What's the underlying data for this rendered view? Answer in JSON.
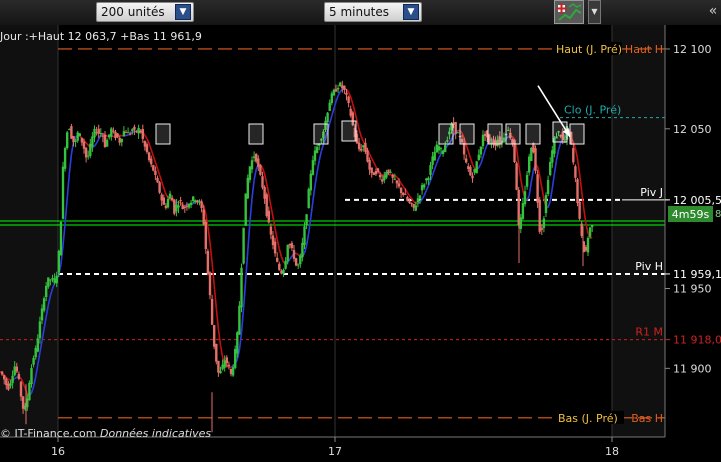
{
  "toolbar": {
    "units_select": "200 unités",
    "interval_select": "5 minutes",
    "dropdown_arrow": "▼",
    "scroll_right": "«"
  },
  "chart": {
    "info_text": "Jour :+Haut 12 063,7 +Bas 11 961,9",
    "watermark": "© IT-Finance.com",
    "watermark_note": "Données indicatives",
    "countdown": "4m59s",
    "countdown_side": "8",
    "colors": {
      "up": "#35c23e",
      "down": "#e5706a",
      "ma_up": "#2b3fe0",
      "ma_down": "#c31010",
      "hilite": "#00ff00",
      "resistance": "#e06020",
      "close_line": "#22aaaa",
      "r1_line": "#cc2222"
    }
  },
  "chart_data": {
    "type": "candlestick",
    "title": "",
    "xlabel": "",
    "ylabel": "",
    "ylim": [
      11857,
      12115
    ],
    "x_ticks": [
      "16",
      "17",
      "18"
    ],
    "y_ticks": [
      "12 100",
      "12 050",
      "12 005,5",
      "11 950",
      "11 900"
    ],
    "levels": [
      {
        "value": 12100,
        "left_label": "Haut (J. Pré)",
        "right_label": "Haut H",
        "badge": "",
        "style": "resistance"
      },
      {
        "value": 12057,
        "left_label": "Clo (J. Pré)",
        "right_label": "",
        "badge": "",
        "style": "close"
      },
      {
        "value": 12005.5,
        "left_label": "",
        "right_label": "Piv J",
        "badge": "12 005,5",
        "style": "pivot"
      },
      {
        "value": 11991,
        "left_label": "",
        "right_label": "",
        "badge": "",
        "style": "current"
      },
      {
        "value": 11959.1,
        "left_label": "",
        "right_label": "Piv H",
        "badge": "11 959,1",
        "style": "pivot"
      },
      {
        "value": 11918,
        "left_label": "",
        "right_label": "R1 M",
        "badge": "11 918,0",
        "style": "r1"
      },
      {
        "value": 11869,
        "left_label": "Bas (J. Pré)",
        "right_label": "Bas H",
        "badge": "",
        "style": "resistance"
      }
    ],
    "price_path": [
      [
        0,
        11898
      ],
      [
        3,
        11895
      ],
      [
        6,
        11890
      ],
      [
        9,
        11888
      ],
      [
        12,
        11896
      ],
      [
        15,
        11902
      ],
      [
        18,
        11895
      ],
      [
        21,
        11883
      ],
      [
        24,
        11872
      ],
      [
        27,
        11880
      ],
      [
        30,
        11895
      ],
      [
        33,
        11906
      ],
      [
        36,
        11912
      ],
      [
        39,
        11925
      ],
      [
        42,
        11936
      ],
      [
        45,
        11950
      ],
      [
        48,
        11955
      ],
      [
        51,
        11956
      ],
      [
        54,
        11954
      ],
      [
        57,
        11960
      ],
      [
        60,
        11980
      ],
      [
        63,
        12025
      ],
      [
        66,
        12046
      ],
      [
        69,
        12052
      ],
      [
        72,
        12044
      ],
      [
        75,
        12040
      ],
      [
        78,
        12048
      ],
      [
        81,
        12044
      ],
      [
        84,
        12038
      ],
      [
        87,
        12030
      ],
      [
        90,
        12038
      ],
      [
        93,
        12046
      ],
      [
        96,
        12050
      ],
      [
        99,
        12047
      ],
      [
        102,
        12048
      ],
      [
        105,
        12040
      ],
      [
        108,
        12044
      ],
      [
        111,
        12050
      ],
      [
        114,
        12046
      ],
      [
        117,
        12045
      ],
      [
        120,
        12042
      ],
      [
        123,
        12048
      ],
      [
        126,
        12049
      ],
      [
        129,
        12046
      ],
      [
        132,
        12050
      ],
      [
        135,
        12047
      ],
      [
        138,
        12050
      ],
      [
        141,
        12048
      ],
      [
        144,
        12040
      ],
      [
        147,
        12035
      ],
      [
        150,
        12028
      ],
      [
        153,
        12025
      ],
      [
        156,
        12018
      ],
      [
        159,
        12012
      ],
      [
        162,
        12005
      ],
      [
        165,
        12000
      ],
      [
        168,
        12006
      ],
      [
        171,
        12010
      ],
      [
        174,
        11998
      ],
      [
        177,
        12003
      ],
      [
        180,
        12005
      ],
      [
        183,
        12000
      ],
      [
        186,
        12002
      ],
      [
        189,
        12004
      ],
      [
        192,
        12005
      ],
      [
        195,
        12007
      ],
      [
        198,
        12004
      ],
      [
        201,
        12002
      ],
      [
        204,
        11990
      ],
      [
        207,
        11965
      ],
      [
        210,
        11945
      ],
      [
        213,
        11920
      ],
      [
        216,
        11906
      ],
      [
        219,
        11895
      ],
      [
        222,
        11900
      ],
      [
        225,
        11906
      ],
      [
        228,
        11902
      ],
      [
        231,
        11896
      ],
      [
        234,
        11905
      ],
      [
        237,
        11918
      ],
      [
        240,
        11945
      ],
      [
        243,
        11985
      ],
      [
        246,
        12010
      ],
      [
        249,
        12025
      ],
      [
        252,
        12030
      ],
      [
        255,
        12035
      ],
      [
        258,
        12026
      ],
      [
        261,
        12018
      ],
      [
        264,
        12010
      ],
      [
        267,
        11996
      ],
      [
        270,
        11985
      ],
      [
        273,
        11978
      ],
      [
        276,
        11968
      ],
      [
        279,
        11962
      ],
      [
        282,
        11960
      ],
      [
        285,
        11966
      ],
      [
        288,
        11980
      ],
      [
        291,
        11975
      ],
      [
        294,
        11970
      ],
      [
        297,
        11962
      ],
      [
        300,
        11968
      ],
      [
        303,
        11980
      ],
      [
        306,
        11995
      ],
      [
        309,
        12012
      ],
      [
        312,
        12030
      ],
      [
        315,
        12035
      ],
      [
        318,
        12040
      ],
      [
        321,
        12045
      ],
      [
        324,
        12050
      ],
      [
        327,
        12060
      ],
      [
        330,
        12068
      ],
      [
        333,
        12072
      ],
      [
        336,
        12075
      ],
      [
        339,
        12078
      ],
      [
        342,
        12076
      ],
      [
        345,
        12073
      ],
      [
        348,
        12066
      ],
      [
        351,
        12058
      ],
      [
        354,
        12048
      ],
      [
        357,
        12040
      ],
      [
        360,
        12036
      ],
      [
        363,
        12040
      ],
      [
        366,
        12035
      ],
      [
        369,
        12026
      ],
      [
        372,
        12020
      ],
      [
        375,
        12024
      ],
      [
        378,
        12022
      ],
      [
        381,
        12018
      ],
      [
        384,
        12020
      ],
      [
        387,
        12025
      ],
      [
        390,
        12022
      ],
      [
        393,
        12018
      ],
      [
        396,
        12016
      ],
      [
        399,
        12013
      ],
      [
        402,
        12010
      ],
      [
        405,
        12008
      ],
      [
        408,
        12004
      ],
      [
        411,
        12002
      ],
      [
        414,
        12000
      ],
      [
        417,
        12005
      ],
      [
        420,
        12010
      ],
      [
        423,
        12015
      ],
      [
        426,
        12018
      ],
      [
        429,
        12022
      ],
      [
        432,
        12030
      ],
      [
        435,
        12036
      ],
      [
        438,
        12040
      ],
      [
        441,
        12036
      ],
      [
        444,
        12038
      ],
      [
        447,
        12044
      ],
      [
        450,
        12050
      ],
      [
        453,
        12054
      ],
      [
        456,
        12048
      ],
      [
        459,
        12046
      ],
      [
        462,
        12040
      ],
      [
        465,
        12030
      ],
      [
        468,
        12025
      ],
      [
        471,
        12020
      ],
      [
        474,
        12022
      ],
      [
        477,
        12030
      ],
      [
        480,
        12038
      ],
      [
        483,
        12045
      ],
      [
        486,
        12048
      ],
      [
        489,
        12040
      ],
      [
        492,
        12043
      ],
      [
        495,
        12040
      ],
      [
        498,
        12044
      ],
      [
        501,
        12040
      ],
      [
        504,
        12046
      ],
      [
        507,
        12050
      ],
      [
        510,
        12046
      ],
      [
        513,
        12040
      ],
      [
        516,
        12020
      ],
      [
        519,
        11985
      ],
      [
        522,
        11998
      ],
      [
        525,
        12012
      ],
      [
        528,
        12026
      ],
      [
        531,
        12040
      ],
      [
        534,
        12036
      ],
      [
        537,
        12010
      ],
      [
        540,
        11985
      ],
      [
        543,
        11990
      ],
      [
        546,
        12008
      ],
      [
        549,
        12025
      ],
      [
        552,
        12035
      ],
      [
        555,
        12045
      ],
      [
        558,
        12048
      ],
      [
        561,
        12046
      ],
      [
        564,
        12040
      ],
      [
        567,
        12050
      ],
      [
        570,
        12046
      ],
      [
        573,
        12030
      ],
      [
        576,
        12015
      ],
      [
        579,
        11995
      ],
      [
        582,
        11980
      ],
      [
        585,
        11970
      ],
      [
        588,
        11982
      ],
      [
        591,
        11990
      ],
      [
        594,
        11994
      ]
    ],
    "signal_boxes": [
      163,
      256,
      321,
      349,
      446,
      467,
      495,
      513,
      533,
      560,
      577
    ],
    "arrow": {
      "from": [
        538,
        12077
      ],
      "to": [
        570,
        12045
      ]
    }
  }
}
